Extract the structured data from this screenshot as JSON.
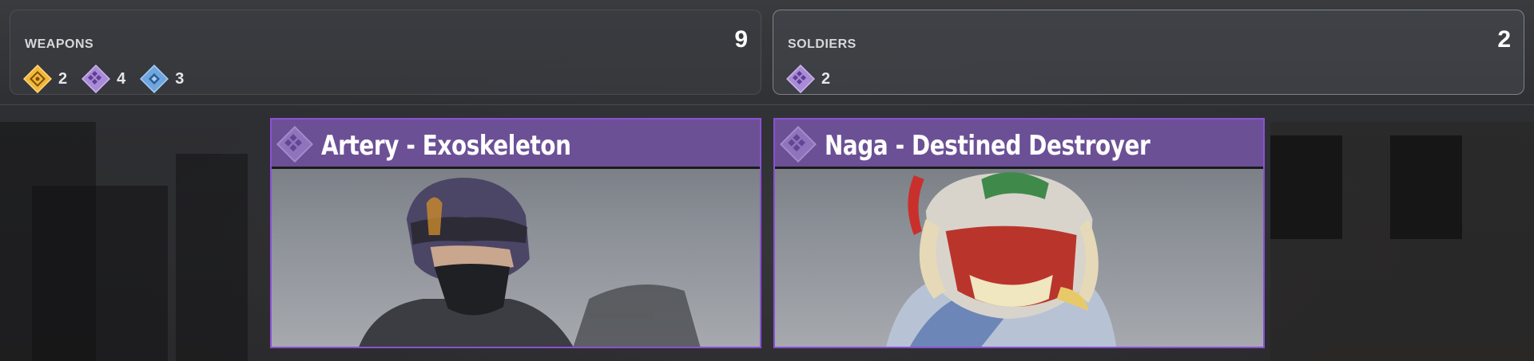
{
  "summary": {
    "weapons": {
      "title": "WEAPONS",
      "total": "9",
      "counts": [
        {
          "icon": "gold-rarity-icon",
          "color": "#f2b73a",
          "value": "2"
        },
        {
          "icon": "purple-rarity-icon",
          "color": "#a98bd8",
          "value": "4"
        },
        {
          "icon": "blue-rarity-icon",
          "color": "#6fa6df",
          "value": "3"
        }
      ]
    },
    "soldiers": {
      "title": "SOLDIERS",
      "total": "2",
      "counts": [
        {
          "icon": "purple-rarity-icon",
          "color": "#a98bd8",
          "value": "2"
        }
      ]
    }
  },
  "cards": [
    {
      "name": "Artery - Exoskeleton",
      "rarity_icon": "purple-rarity-icon",
      "portrait": "soldier-portrait-artery"
    },
    {
      "name": "Naga - Destined Destroyer",
      "rarity_icon": "purple-rarity-icon",
      "portrait": "soldier-portrait-naga"
    }
  ],
  "colors": {
    "epic_border": "#8b50d6",
    "epic_header": "#6c5096",
    "legendary": "#f2b73a",
    "rare": "#6fa6df"
  }
}
